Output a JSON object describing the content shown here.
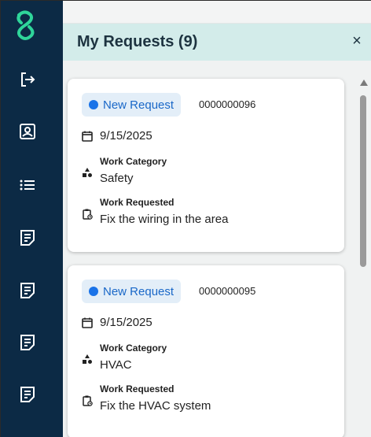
{
  "sidebar": {
    "logo_icon": "app-logo-icon",
    "items": [
      {
        "icon": "logout-icon"
      },
      {
        "icon": "contact-card-icon"
      },
      {
        "icon": "list-icon"
      },
      {
        "icon": "note-icon"
      },
      {
        "icon": "note-icon"
      },
      {
        "icon": "note-icon"
      },
      {
        "icon": "note-icon"
      }
    ]
  },
  "header": {
    "title": "My Requests (9)",
    "close_label": "×"
  },
  "requests": [
    {
      "status": "New Request",
      "id": "0000000096",
      "date": "9/15/2025",
      "category_label": "Work Category",
      "category": "Safety",
      "work_label": "Work Requested",
      "work": "Fix the wiring in the area"
    },
    {
      "status": "New Request",
      "id": "0000000095",
      "date": "9/15/2025",
      "category_label": "Work Category",
      "category": "HVAC",
      "work_label": "Work Requested",
      "work": "Fix the HVAC system"
    }
  ],
  "colors": {
    "sidebar": "#0c2a45",
    "accent": "#2fd59a",
    "header": "#d3ecea",
    "badge_bg": "#e3eef8",
    "badge_dot": "#1a73e8"
  }
}
